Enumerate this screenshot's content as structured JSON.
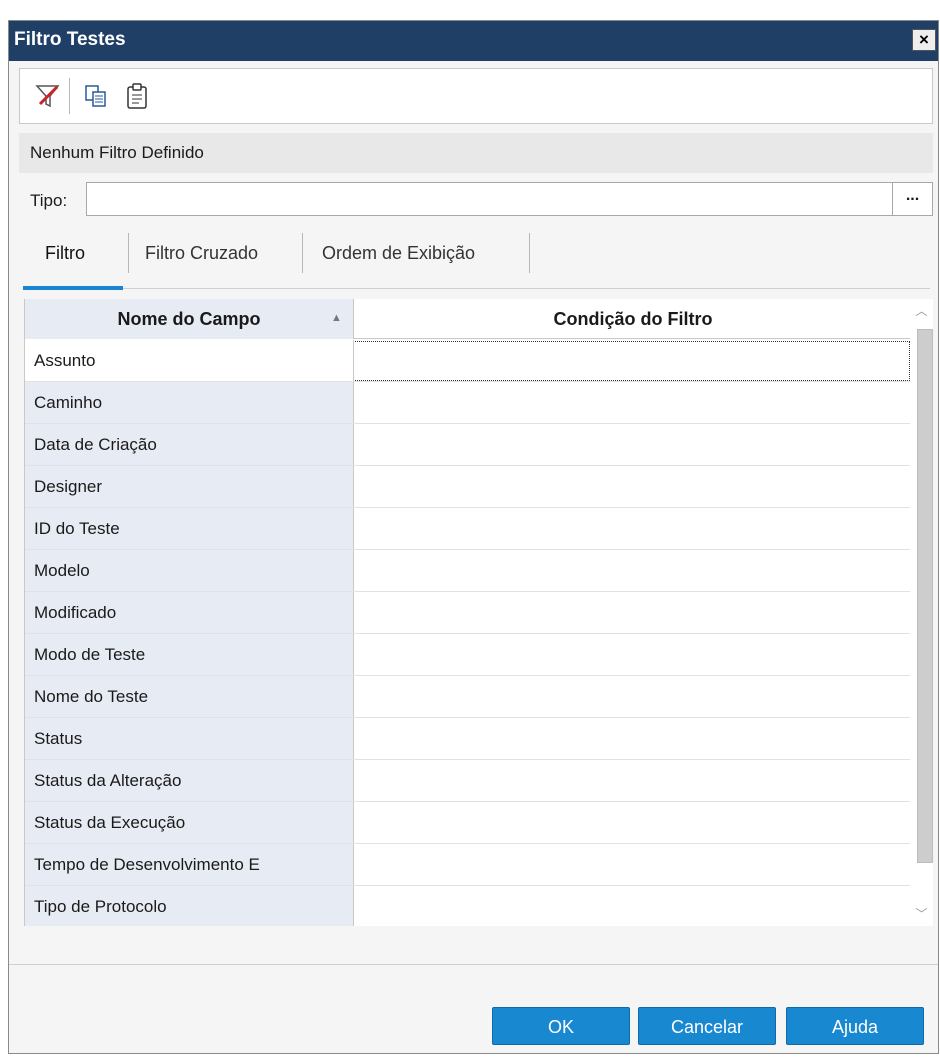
{
  "window": {
    "title": "Filtro Testes",
    "close_label": "×"
  },
  "toolbar": {
    "icons": [
      "clear-filter-icon",
      "copy-icon",
      "paste-icon"
    ]
  },
  "status": {
    "text": "Nenhum Filtro Definido"
  },
  "tipo": {
    "label": "Tipo:",
    "value": "",
    "browse_label": "..."
  },
  "tabs": [
    {
      "label": "Filtro",
      "active": true
    },
    {
      "label": "Filtro Cruzado",
      "active": false
    },
    {
      "label": "Ordem de Exibição",
      "active": false
    }
  ],
  "grid": {
    "columns": [
      "Nome do Campo",
      "Condição do Filtro"
    ],
    "sort_indicator": "▲",
    "rows": [
      {
        "field": "Assunto",
        "condition": ""
      },
      {
        "field": "Caminho",
        "condition": ""
      },
      {
        "field": "Data de Criação",
        "condition": ""
      },
      {
        "field": "Designer",
        "condition": ""
      },
      {
        "field": "ID do Teste",
        "condition": ""
      },
      {
        "field": "Modelo",
        "condition": ""
      },
      {
        "field": "Modificado",
        "condition": ""
      },
      {
        "field": "Modo de Teste",
        "condition": ""
      },
      {
        "field": "Nome do Teste",
        "condition": ""
      },
      {
        "field": "Status",
        "condition": ""
      },
      {
        "field": "Status da Alteração",
        "condition": ""
      },
      {
        "field": "Status da Execução",
        "condition": ""
      },
      {
        "field": "Tempo de Desenvolvimento E",
        "condition": ""
      },
      {
        "field": "Tipo de Protocolo",
        "condition": ""
      }
    ]
  },
  "buttons": {
    "ok": "OK",
    "cancel": "Cancelar",
    "help": "Ajuda"
  },
  "colors": {
    "title_bar": "#1f3f66",
    "accent": "#1888d0",
    "field_column": "#e7ebf3"
  }
}
